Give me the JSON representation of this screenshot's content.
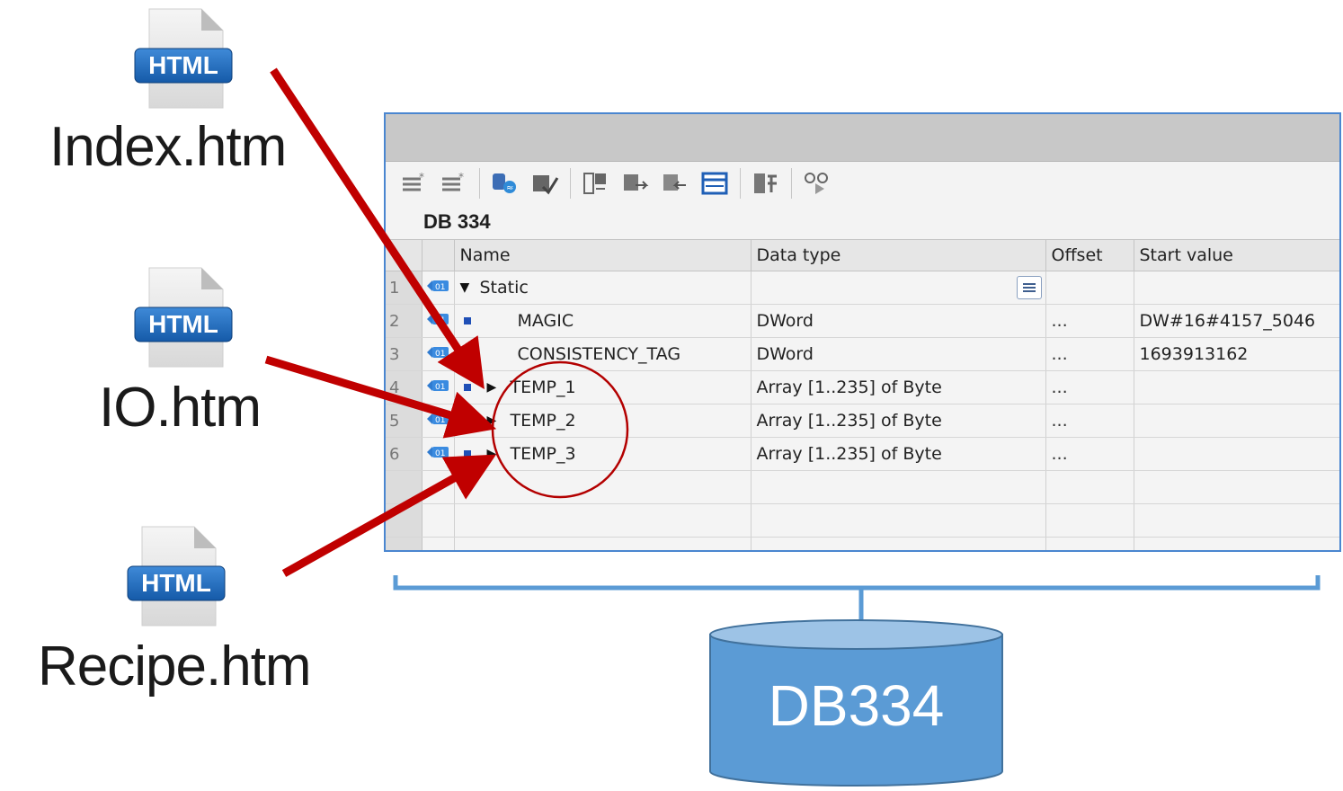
{
  "files": [
    {
      "badge": "HTML",
      "label": "Index.htm"
    },
    {
      "badge": "HTML",
      "label": "IO.htm"
    },
    {
      "badge": "HTML",
      "label": "Recipe.htm"
    }
  ],
  "editor": {
    "title": "DB 334",
    "columns": [
      "Name",
      "Data type",
      "Offset",
      "Start value"
    ],
    "rows": [
      {
        "num": "1",
        "name": "Static",
        "type": "",
        "offset": "",
        "start": ""
      },
      {
        "num": "2",
        "name": "MAGIC",
        "type": "DWord",
        "offset": "...",
        "start": "DW#16#4157_5046"
      },
      {
        "num": "3",
        "name": "CONSISTENCY_TAG",
        "type": "DWord",
        "offset": "...",
        "start": "1693913162"
      },
      {
        "num": "4",
        "name": "TEMP_1",
        "type": "Array [1..235] of Byte",
        "offset": "...",
        "start": ""
      },
      {
        "num": "5",
        "name": "TEMP_2",
        "type": "Array [1..235] of Byte",
        "offset": "...",
        "start": ""
      },
      {
        "num": "6",
        "name": "TEMP_3",
        "type": "Array [1..235] of Byte",
        "offset": "...",
        "start": ""
      }
    ]
  },
  "database": {
    "label": "DB334"
  },
  "colors": {
    "arrow": "#c00000",
    "bracket": "#5b9bd5",
    "cylinder": "#5b9bd5",
    "window_border": "#4a86d0"
  }
}
